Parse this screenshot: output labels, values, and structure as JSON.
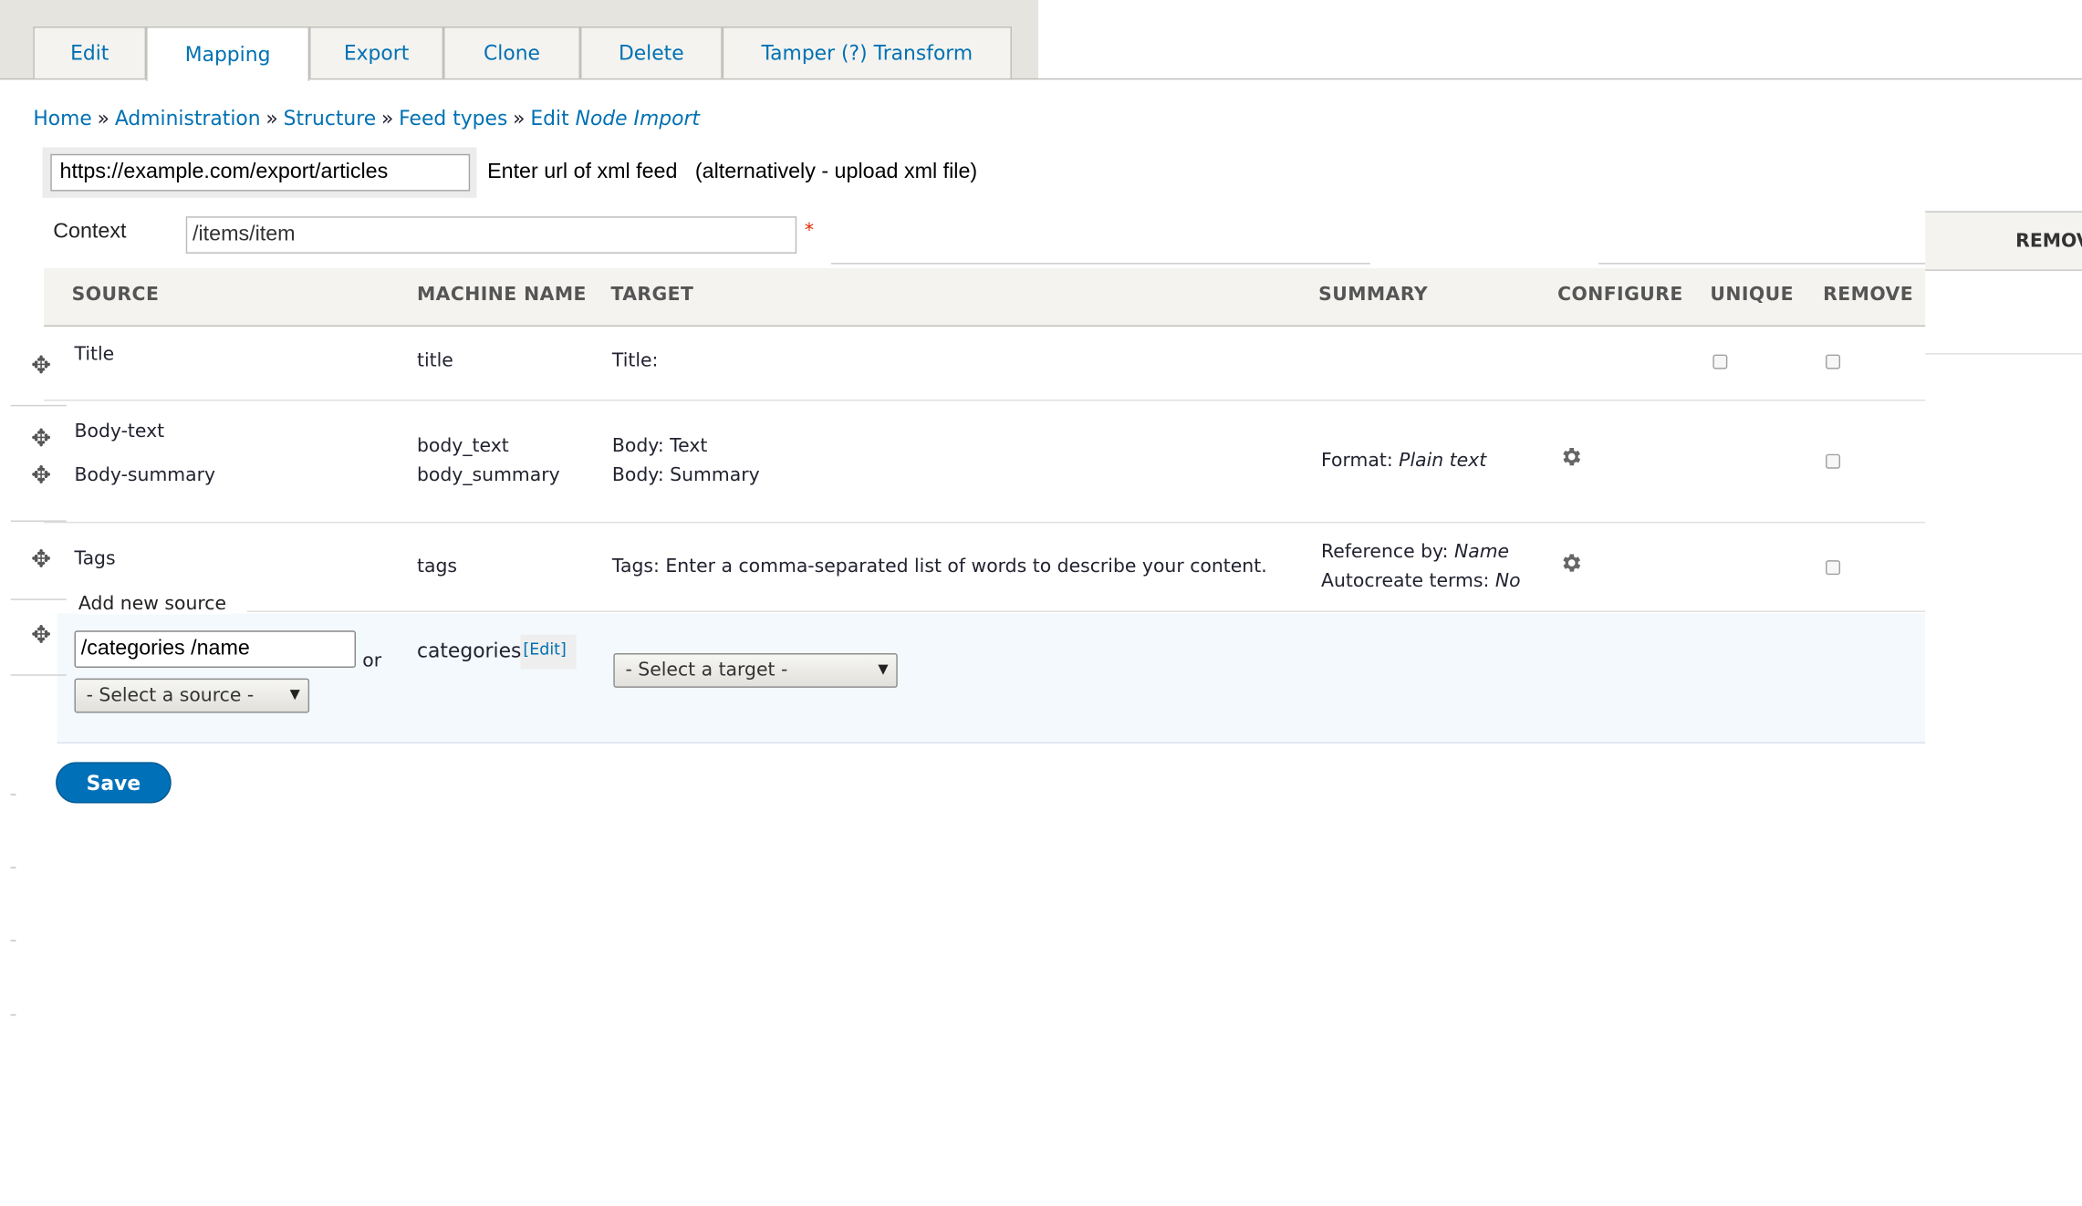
{
  "tabs": [
    {
      "label": "Edit",
      "active": false
    },
    {
      "label": "Mapping",
      "active": true
    },
    {
      "label": "Export",
      "active": false
    },
    {
      "label": "Clone",
      "active": false
    },
    {
      "label": "Delete",
      "active": false
    },
    {
      "label": "Tamper (?) Transform",
      "active": false
    }
  ],
  "breadcrumb": {
    "home": "Home",
    "administration": "Administration",
    "structure": "Structure",
    "feed_types": "Feed types",
    "edit_prefix": "Edit",
    "edit_name": "Node Import",
    "separator": "»"
  },
  "url_field": {
    "value": "https://example.com/export/articles",
    "hint": "Enter url of xml feed   (alternatively - upload xml file)"
  },
  "context": {
    "label": "Context",
    "value": "/items/item",
    "required_mark": "*"
  },
  "right_partial_header": "REMOV",
  "table": {
    "headers": {
      "source": "SOURCE",
      "machine_name": "MACHINE NAME",
      "target": "TARGET",
      "summary": "SUMMARY",
      "configure": "CONFIGURE",
      "unique": "UNIQUE",
      "remove": "REMOVE"
    },
    "rows": [
      {
        "source": "Title",
        "machine": "title",
        "target": "Title:"
      },
      {
        "source": "Body-text",
        "source2": "Body-summary",
        "machine": "body_text",
        "machine2": "body_summary",
        "target": "Body: Text",
        "target2": "Body: Summary",
        "summary_label": "Format:",
        "summary_value": "Plain text"
      },
      {
        "source": "Tags",
        "machine": "tags",
        "target": "Tags: Enter a comma-separated list of words to describe your content.",
        "summary_label": "Reference by:",
        "summary_value": "Name",
        "summary_label2": "Autocreate terms:",
        "summary_value2": "No"
      }
    ]
  },
  "add_source": {
    "label": "Add new source",
    "input_value": "/categories /name",
    "or": "or",
    "select_source": "- Select a source -",
    "machine_name": "categories",
    "edit_link": "[Edit]",
    "select_target": "- Select a target -"
  },
  "save_label": "Save",
  "colors": {
    "link": "#0071b3",
    "primary_button": "#0071b8",
    "header_bg": "#f4f3f0",
    "tabbar_bg": "#e6e4df"
  }
}
